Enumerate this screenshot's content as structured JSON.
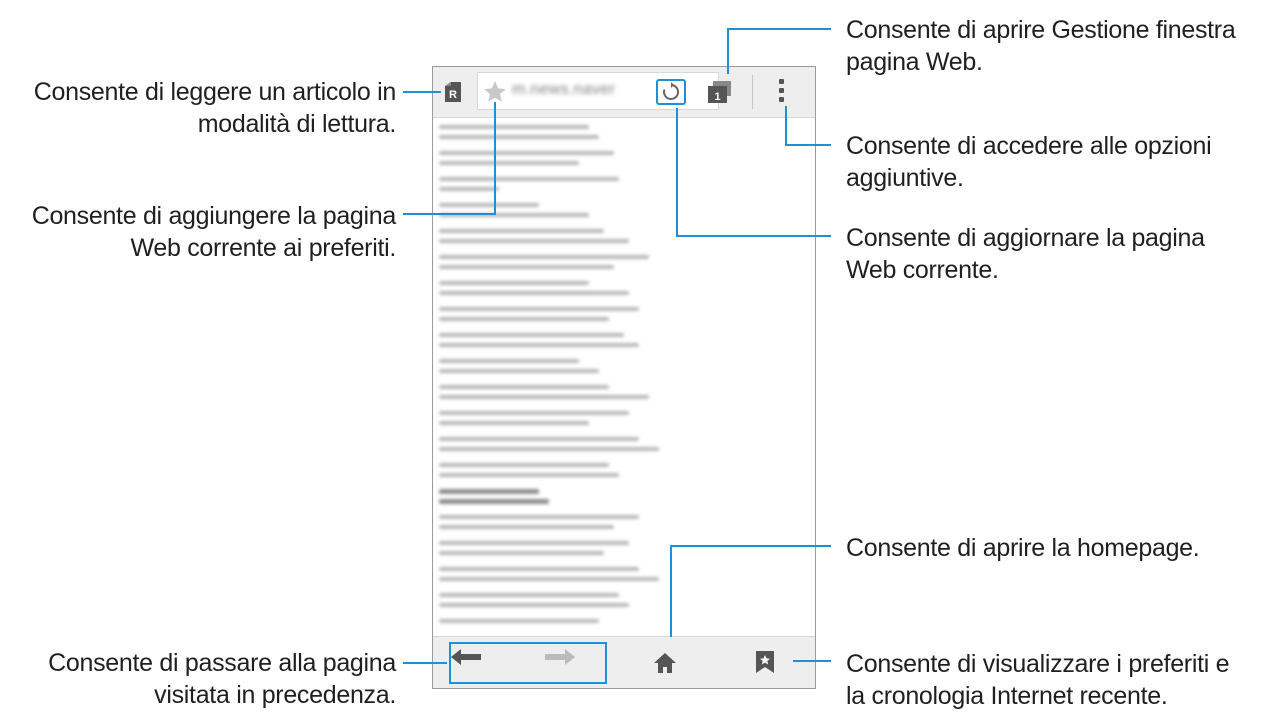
{
  "browser": {
    "url_text": "m.news.naver",
    "tab_count": "1"
  },
  "callouts": {
    "reader": [
      "Consente di leggere un articolo in",
      "modalità di lettura."
    ],
    "bookmark_add": [
      "Consente di aggiungere la pagina",
      "Web corrente ai preferiti."
    ],
    "back": [
      "Consente di passare alla pagina",
      "visitata in precedenza."
    ],
    "tab_manager": [
      "Consente di aprire Gestione finestra",
      "pagina Web."
    ],
    "more_options": [
      "Consente di accedere alle opzioni",
      "aggiuntive."
    ],
    "refresh": [
      "Consente di aggiornare la pagina",
      "Web corrente."
    ],
    "home": [
      "Consente di aprire la homepage."
    ],
    "bookmarks_history": [
      "Consente di visualizzare i preferiti e",
      "la cronologia Internet recente."
    ]
  },
  "icons": {
    "reader": "reader-mode-icon",
    "star": "star-icon",
    "refresh": "refresh-icon",
    "tabs": "tabs-icon",
    "more": "more-vert-icon",
    "back": "arrow-left-icon",
    "forward": "arrow-right-icon",
    "home": "home-icon",
    "bookmarks": "bookmark-icon"
  },
  "colors": {
    "accent": "#1e90d6",
    "toolbar": "#eeeeee",
    "icon": "#555555"
  }
}
